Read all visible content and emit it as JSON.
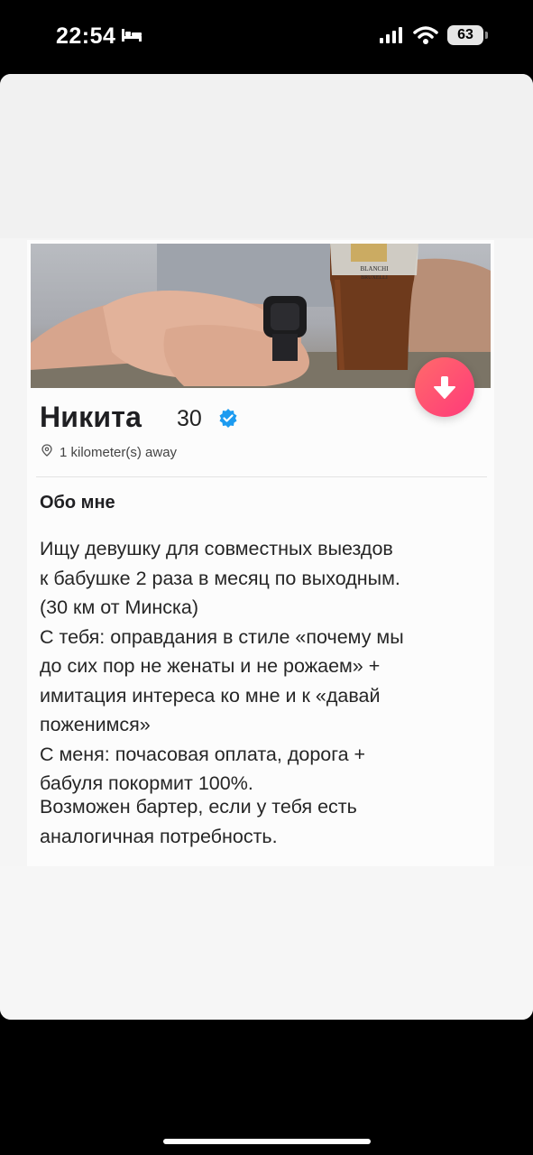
{
  "status_bar": {
    "time": "22:54",
    "battery": "63",
    "icons": [
      "bed-icon",
      "signal-icon",
      "wifi-icon",
      "battery-icon"
    ]
  },
  "profile": {
    "name": "Никита",
    "age": "30",
    "verified": true,
    "distance": "1 kilometer(s) away",
    "photo_text": [
      "BLANCHI",
      "BRUXELLI"
    ]
  },
  "about": {
    "title": "Обо мне",
    "bio_lines": [
      "Ищу девушку для совместных выездов",
      "к бабушке 2 раза в месяц по выходным.",
      "(30 км от Минска)",
      "С тебя: оправдания в стиле «почему мы",
      "до сих пор не женаты и не рожаем» +",
      "имитация интереса ко мне и к «давай",
      "поженимся»",
      "С меня: почасовая оплата, дорога +",
      "бабуля покормит 100%."
    ],
    "extra_lines": [
      "Возможен бартер, если у тебя есть",
      "аналогичная потребность."
    ]
  },
  "colors": {
    "accent": "#ff4b6e",
    "verified": "#1d9bf0"
  }
}
